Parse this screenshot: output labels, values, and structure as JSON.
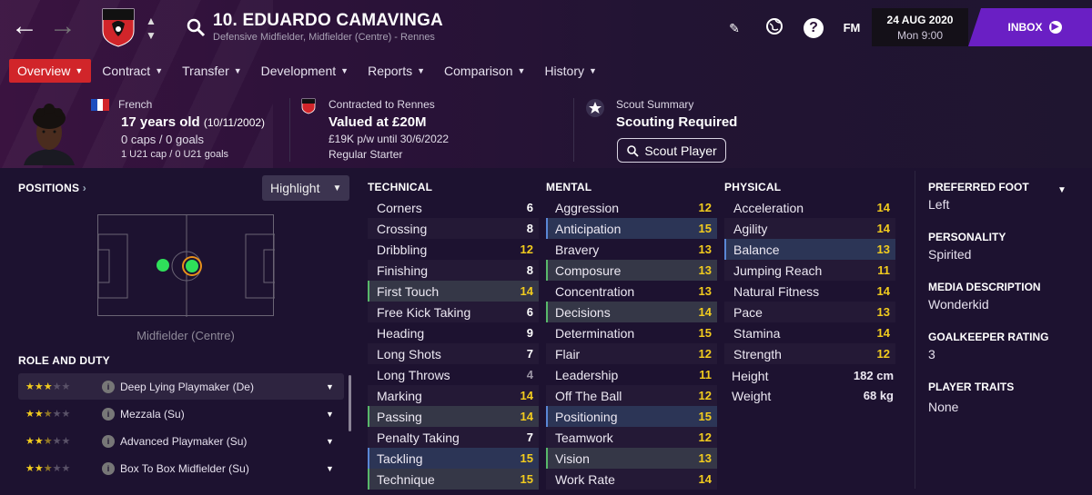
{
  "header": {
    "player_name": "10. EDUARDO CAMAVINGA",
    "subtitle": "Defensive Midfielder, Midfielder (Centre) - Rennes",
    "date": "24 AUG 2020",
    "time": "Mon 9:00",
    "inbox_label": "INBOX",
    "fm_label": "FM",
    "help_label": "?"
  },
  "tabs": [
    {
      "label": "Overview"
    },
    {
      "label": "Contract"
    },
    {
      "label": "Transfer"
    },
    {
      "label": "Development"
    },
    {
      "label": "Reports"
    },
    {
      "label": "Comparison"
    },
    {
      "label": "History"
    }
  ],
  "info": {
    "nationality": "French",
    "age": "17 years old",
    "dob": "(10/11/2002)",
    "caps": "0 caps / 0 goals",
    "u21": "1 U21 cap / 0 U21 goals",
    "contract_label": "Contracted to Rennes",
    "value": "Valued at £20M",
    "wage": "£19K p/w until 30/6/2022",
    "status": "Regular Starter",
    "scout_label": "Scout Summary",
    "scout_status": "Scouting Required",
    "scout_button": "Scout Player"
  },
  "positions": {
    "title": "POSITIONS",
    "highlight_label": "Highlight",
    "pitch_label": "Midfielder (Centre)",
    "role_title": "ROLE AND DUTY",
    "roles": [
      {
        "name": "Deep Lying Playmaker (De)",
        "stars": 3
      },
      {
        "name": "Mezzala (Su)",
        "stars": 2.5
      },
      {
        "name": "Advanced Playmaker (Su)",
        "stars": 2.5
      },
      {
        "name": "Box To Box Midfielder (Su)",
        "stars": 2.5
      }
    ]
  },
  "technical": {
    "title": "TECHNICAL",
    "attrs": [
      {
        "name": "Corners",
        "value": "6"
      },
      {
        "name": "Crossing",
        "value": "8"
      },
      {
        "name": "Dribbling",
        "value": "12"
      },
      {
        "name": "Finishing",
        "value": "8"
      },
      {
        "name": "First Touch",
        "value": "14"
      },
      {
        "name": "Free Kick Taking",
        "value": "6"
      },
      {
        "name": "Heading",
        "value": "9"
      },
      {
        "name": "Long Shots",
        "value": "7"
      },
      {
        "name": "Long Throws",
        "value": "4"
      },
      {
        "name": "Marking",
        "value": "14"
      },
      {
        "name": "Passing",
        "value": "14"
      },
      {
        "name": "Penalty Taking",
        "value": "7"
      },
      {
        "name": "Tackling",
        "value": "15"
      },
      {
        "name": "Technique",
        "value": "15"
      }
    ]
  },
  "mental": {
    "title": "MENTAL",
    "attrs": [
      {
        "name": "Aggression",
        "value": "12"
      },
      {
        "name": "Anticipation",
        "value": "15"
      },
      {
        "name": "Bravery",
        "value": "13"
      },
      {
        "name": "Composure",
        "value": "13"
      },
      {
        "name": "Concentration",
        "value": "13"
      },
      {
        "name": "Decisions",
        "value": "14"
      },
      {
        "name": "Determination",
        "value": "15"
      },
      {
        "name": "Flair",
        "value": "12"
      },
      {
        "name": "Leadership",
        "value": "11"
      },
      {
        "name": "Off The Ball",
        "value": "12"
      },
      {
        "name": "Positioning",
        "value": "15"
      },
      {
        "name": "Teamwork",
        "value": "12"
      },
      {
        "name": "Vision",
        "value": "13"
      },
      {
        "name": "Work Rate",
        "value": "14"
      }
    ]
  },
  "physical": {
    "title": "PHYSICAL",
    "attrs": [
      {
        "name": "Acceleration",
        "value": "14"
      },
      {
        "name": "Agility",
        "value": "14"
      },
      {
        "name": "Balance",
        "value": "13"
      },
      {
        "name": "Jumping Reach",
        "value": "11"
      },
      {
        "name": "Natural Fitness",
        "value": "14"
      },
      {
        "name": "Pace",
        "value": "13"
      },
      {
        "name": "Stamina",
        "value": "14"
      },
      {
        "name": "Strength",
        "value": "12"
      }
    ],
    "height_label": "Height",
    "height": "182 cm",
    "weight_label": "Weight",
    "weight": "68 kg"
  },
  "right": {
    "foot_title": "PREFERRED FOOT",
    "foot": "Left",
    "personality_title": "PERSONALITY",
    "personality": "Spirited",
    "media_title": "MEDIA DESCRIPTION",
    "media": "Wonderkid",
    "gk_title": "GOALKEEPER RATING",
    "gk": "3",
    "traits_title": "PLAYER TRAITS",
    "traits": "None"
  },
  "colors": {
    "active_tab": "#d1252a",
    "inbox": "#6a1fc4",
    "value_high": "#f2cc1e",
    "value_normal": "#ffffff",
    "value_low": "#9c96a6",
    "highlight_green": "#58b86a",
    "highlight_blue": "#5a87d6"
  }
}
